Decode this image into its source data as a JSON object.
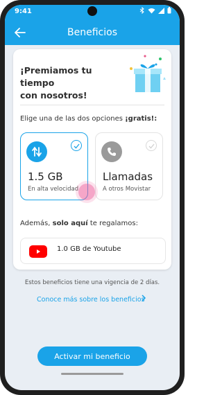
{
  "status": {
    "time": "9:41"
  },
  "appbar": {
    "title": "Beneficios"
  },
  "card": {
    "headline_line1": "¡Premiamos tu tiempo",
    "headline_line2": "con nosotros!",
    "choose_text": "Elige una de las dos opciones",
    "choose_bold": "¡gratis!:",
    "options": [
      {
        "title": "1.5 GB",
        "subtitle": "En alta velocidad",
        "icon": "data-transfer-icon",
        "selected": true
      },
      {
        "title": "Llamadas",
        "subtitle": "A otros Movistar",
        "icon": "phone-icon",
        "selected": false
      }
    ],
    "extra_prefix": "Además,",
    "extra_bold": "solo aquí",
    "extra_suffix": "te regalamos:",
    "youtube": {
      "label": "1.0 GB de Youtube",
      "icon": "youtube-logo"
    }
  },
  "note": {
    "prefix": "Estos beneficios tiene una",
    "highlight": "vigencia de 2 días."
  },
  "link": {
    "label": "Conoce más sobre los beneficios"
  },
  "cta": {
    "label": "Activar mi beneficio"
  },
  "colors": {
    "accent": "#1aa3e8",
    "background": "#e9eef4",
    "youtube": "#ff0000"
  }
}
